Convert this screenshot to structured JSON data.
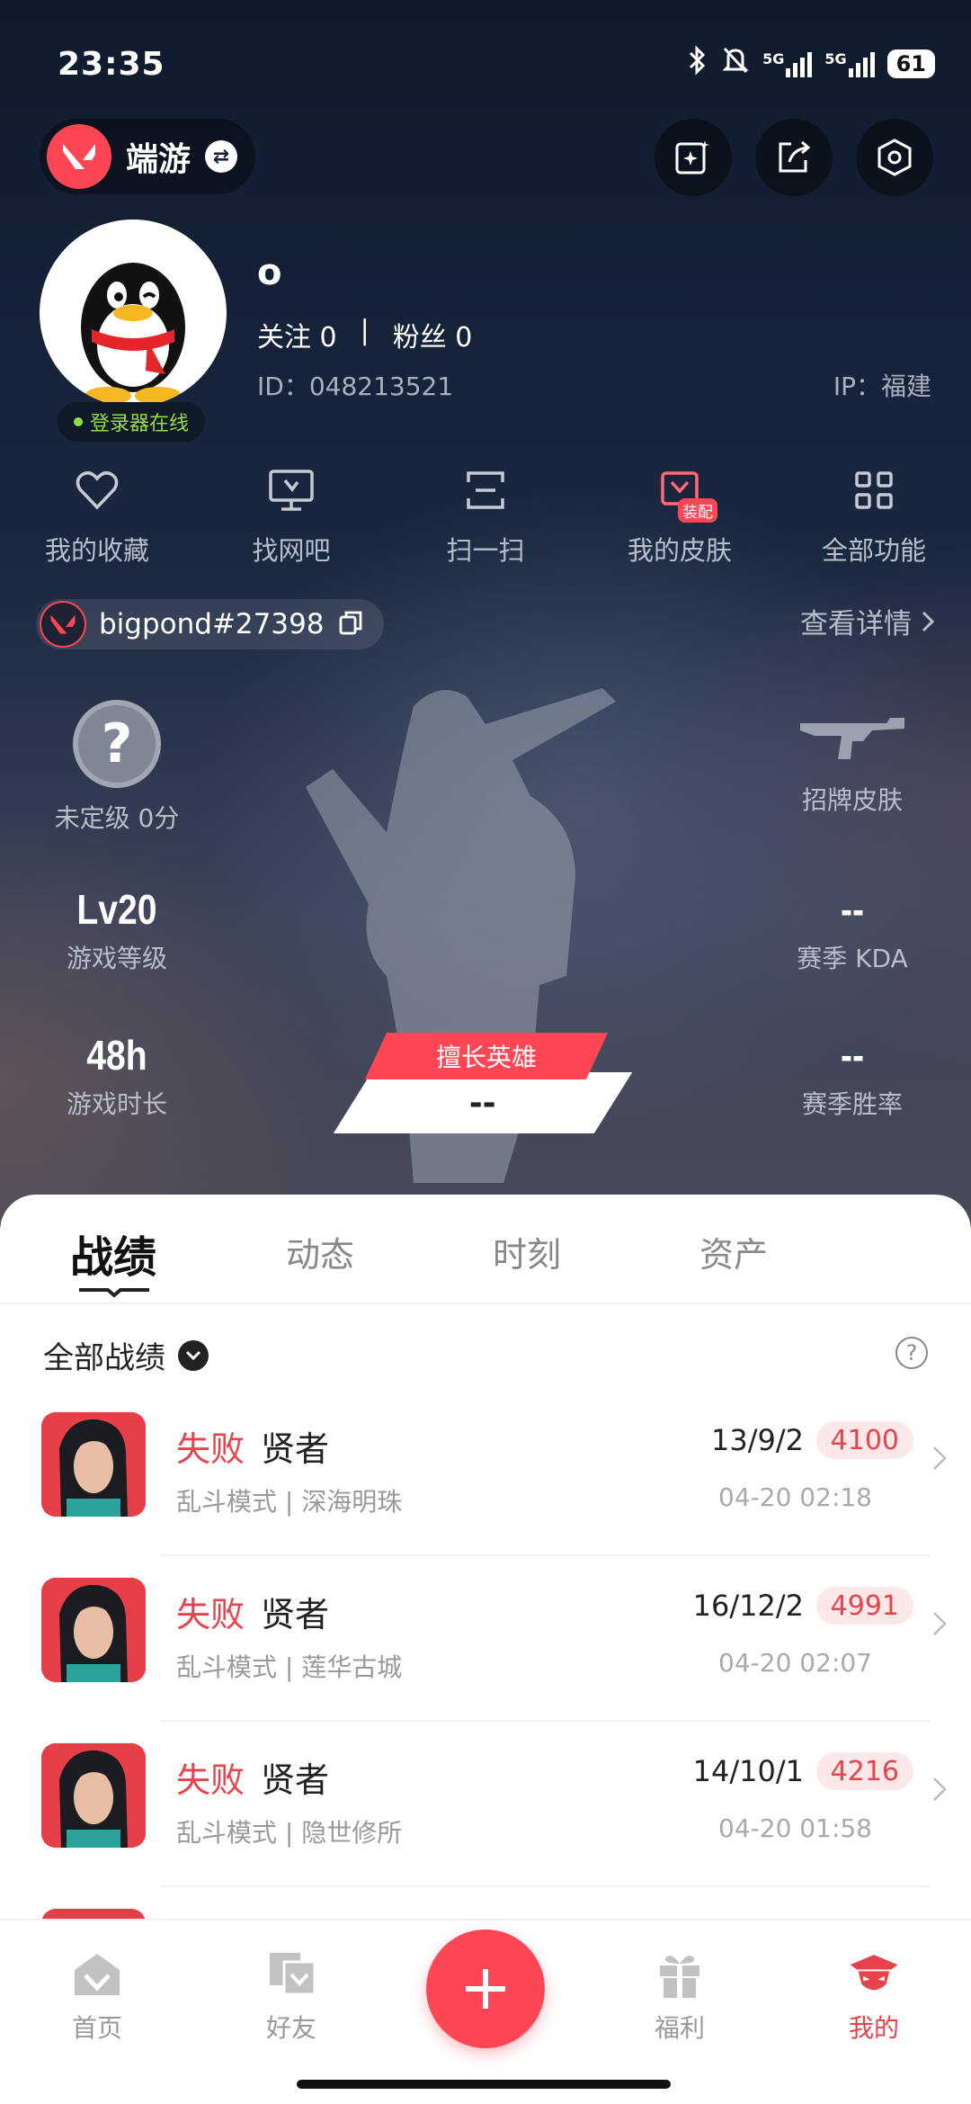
{
  "status_bar": {
    "time": "23:35",
    "battery": "61",
    "net1": "5G",
    "net2": "5G"
  },
  "header": {
    "game_name": "端游"
  },
  "profile": {
    "nickname": "o",
    "follow_label": "关注",
    "follow_count": "0",
    "fans_label": "粉丝",
    "fans_count": "0",
    "divider": "|",
    "id_text": "ID：048213521",
    "ip_text": "IP：福建",
    "online_status": "登录器在线"
  },
  "quick_actions": [
    {
      "label": "我的收藏",
      "icon": "heart-icon"
    },
    {
      "label": "找网吧",
      "icon": "monitor-icon"
    },
    {
      "label": "扫一扫",
      "icon": "scan-icon"
    },
    {
      "label": "我的皮肤",
      "icon": "skin-icon",
      "badge": "装配"
    },
    {
      "label": "全部功能",
      "icon": "grid-icon"
    }
  ],
  "account": {
    "riot_id": "bigpond#27398",
    "detail_link": "查看详情"
  },
  "stats": {
    "rank": {
      "icon_text": "?",
      "label": "未定级 0分"
    },
    "skin": {
      "label": "招牌皮肤"
    },
    "level": {
      "value": "Lv20",
      "label": "游戏等级"
    },
    "kda": {
      "value": "--",
      "label": "赛季 KDA"
    },
    "hours": {
      "value": "48h",
      "label": "游戏时长"
    },
    "winrate": {
      "value": "--",
      "label": "赛季胜率"
    },
    "best_hero": {
      "tag": "擅长英雄",
      "value": "--"
    }
  },
  "tabs": [
    "战绩",
    "动态",
    "时刻",
    "资产"
  ],
  "filter": {
    "label": "全部战绩",
    "help": "?"
  },
  "matches": [
    {
      "result": "失败",
      "agent": "贤者",
      "mode": "乱斗模式 | 深海明珠",
      "kda": "13/9/2",
      "score": "4100",
      "time": "04-20 02:18"
    },
    {
      "result": "失败",
      "agent": "贤者",
      "mode": "乱斗模式 | 莲华古城",
      "kda": "16/12/2",
      "score": "4991",
      "time": "04-20 02:07"
    },
    {
      "result": "失败",
      "agent": "贤者",
      "mode": "乱斗模式 | 隐世修所",
      "kda": "14/10/1",
      "score": "4216",
      "time": "04-20 01:58"
    }
  ],
  "bottom_nav": [
    {
      "label": "首页",
      "icon": "home-icon"
    },
    {
      "label": "好友",
      "icon": "friends-icon"
    },
    {
      "label": "福利",
      "icon": "gift-icon"
    },
    {
      "label": "我的",
      "icon": "profile-icon",
      "active": true
    }
  ],
  "colors": {
    "accent": "#ff4655",
    "loss": "#e8434c",
    "online": "#8de04a"
  }
}
